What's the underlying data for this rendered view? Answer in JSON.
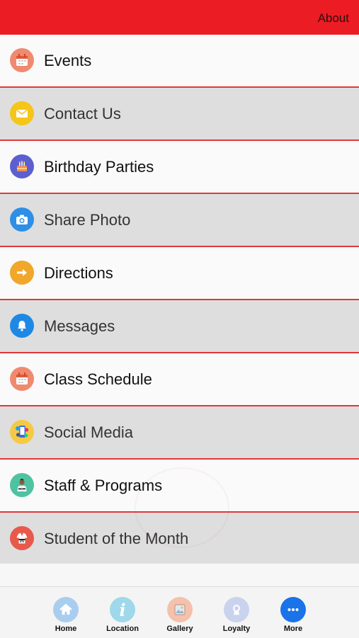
{
  "header": {
    "about_label": "About"
  },
  "menu": {
    "items": [
      {
        "label": "Events",
        "icon": "calendar-icon"
      },
      {
        "label": "Contact Us",
        "icon": "envelope-icon"
      },
      {
        "label": "Birthday Parties",
        "icon": "cake-icon"
      },
      {
        "label": "Share Photo",
        "icon": "camera-icon"
      },
      {
        "label": "Directions",
        "icon": "arrow-right-icon"
      },
      {
        "label": "Messages",
        "icon": "bell-icon"
      },
      {
        "label": "Class Schedule",
        "icon": "calendar-icon"
      },
      {
        "label": "Social Media",
        "icon": "social-media-icon"
      },
      {
        "label": "Staff & Programs",
        "icon": "karate-instructor-icon"
      },
      {
        "label": "Student of the Month",
        "icon": "karate-gi-icon"
      }
    ]
  },
  "tabbar": {
    "tabs": [
      {
        "label": "Home",
        "icon": "home-icon"
      },
      {
        "label": "Location",
        "icon": "info-icon"
      },
      {
        "label": "Gallery",
        "icon": "gallery-icon"
      },
      {
        "label": "Loyalty",
        "icon": "loyalty-icon"
      },
      {
        "label": "More",
        "icon": "more-icon"
      }
    ]
  },
  "colors": {
    "header": "#ec1c24",
    "row_divider": "#e0383c",
    "more_accent": "#1a73e8"
  }
}
